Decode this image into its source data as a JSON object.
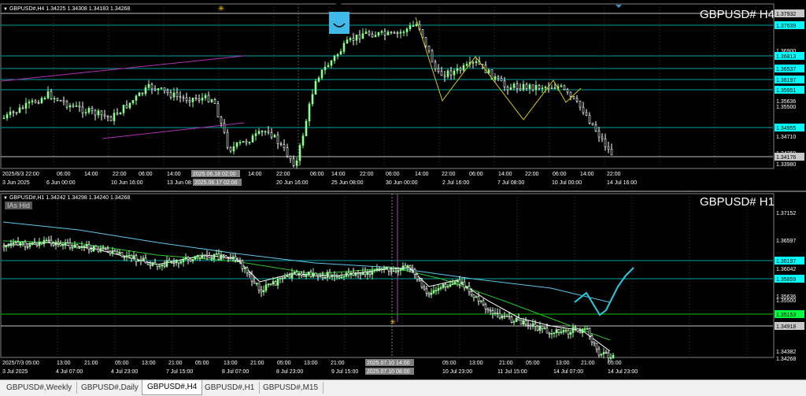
{
  "colors": {
    "bull": "#8cff8c",
    "bear": "#ffffff",
    "grid": "#3a3a3a",
    "hline": "#00a0a0",
    "accent_cyan": "#00ffff",
    "purple": "#b030b0",
    "yellow": "#d8c800"
  },
  "top_chart": {
    "header": "GBPUSD#,H4  1.34225 1.34308 1.34183 1.34268",
    "title": "GBPUSD# H4",
    "price_labels": [
      {
        "value": "1.37932",
        "style": "gray"
      },
      {
        "value": "1.37639",
        "style": "cyan"
      },
      {
        "value": "1.36900",
        "style": "plain"
      },
      {
        "value": "1.36813",
        "style": "cyan"
      },
      {
        "value": "1.36537",
        "style": "cyan"
      },
      {
        "value": "1.36197",
        "style": "cyan"
      },
      {
        "value": "1.35951",
        "style": "cyan"
      },
      {
        "value": "1.35636",
        "style": "plain"
      },
      {
        "value": "1.35500",
        "style": "plain"
      },
      {
        "value": "1.34955",
        "style": "cyan"
      },
      {
        "value": "1.34710",
        "style": "plain"
      },
      {
        "value": "1.34268",
        "style": "plain"
      },
      {
        "value": "1.34176",
        "style": "gray"
      },
      {
        "value": "1.33980",
        "style": "plain"
      }
    ],
    "time_upper": [
      "2025/6/3 22:00",
      "06:00",
      "14:00",
      "22:00",
      "06:00",
      "14:00",
      "2025.06.18 02:00",
      "14:00",
      "22:00",
      "06:00",
      "14:00",
      "22:00",
      "06:00",
      "14:00",
      "22:00",
      "06:00",
      "14:00",
      "22:00",
      "06:00",
      "14:00",
      "22:00"
    ],
    "time_lower": [
      "3 Jun 2025",
      "6 Jun 00:00",
      "10 Jun 16:00",
      "13 Jun 08:00",
      "2025.06.17 02:00",
      "20 Jun 16:00",
      "25 Jun 08:00",
      "30 Jun 00:00",
      "2 Jul 16:00",
      "7 Jul 08:00",
      "10 Jul 00:00",
      "14 Jul 16:00"
    ]
  },
  "bottom_chart": {
    "header": "GBPUSD#,H1  1.34242 1.34298 1.34240 1.34268",
    "title": "GBPUSD# H1",
    "ashi_label": "IAs Hid",
    "price_labels": [
      {
        "value": "1.37152",
        "style": "plain"
      },
      {
        "value": "1.36597",
        "style": "plain"
      },
      {
        "value": "1.36197",
        "style": "cyan"
      },
      {
        "value": "1.36042",
        "style": "plain"
      },
      {
        "value": "1.35859",
        "style": "cyan"
      },
      {
        "value": "1.35636",
        "style": "plain"
      },
      {
        "value": "1.35500",
        "style": "plain"
      },
      {
        "value": "1.35153",
        "style": "green"
      },
      {
        "value": "1.34918",
        "style": "gray"
      },
      {
        "value": "1.34382",
        "style": "plain"
      },
      {
        "value": "1.34268",
        "style": "plain"
      }
    ],
    "time_upper": [
      "2025/7/3 05:00",
      "13:00",
      "21:00",
      "05:00",
      "13:00",
      "21:00",
      "05:00",
      "13:00",
      "21:00",
      "05:00",
      "13:00",
      "21:00",
      "2025.07.10 14:00",
      "05:00",
      "13:00",
      "21:00",
      "05:00",
      "13:00",
      "21:00",
      "05:00"
    ],
    "time_lower": [
      "3 Jul 2025",
      "4 Jul 07:00",
      "4 Jul 23:00",
      "7 Jul 15:00",
      "8 Jul 07:00",
      "8 Jul 23:00",
      "9 Jul 15:00",
      "2025.07.10 08:00",
      "10 Jul 23:00",
      "11 Jul 15:00",
      "14 Jul 07:00",
      "14 Jul 23:00"
    ]
  },
  "tabs": [
    "GBPUSD#,Weekly",
    "GBPUSD#,Daily",
    "GBPUSD#,H4",
    "GBPUSD#,H1",
    "GBPUSD#,M15"
  ],
  "active_tab": 2
}
